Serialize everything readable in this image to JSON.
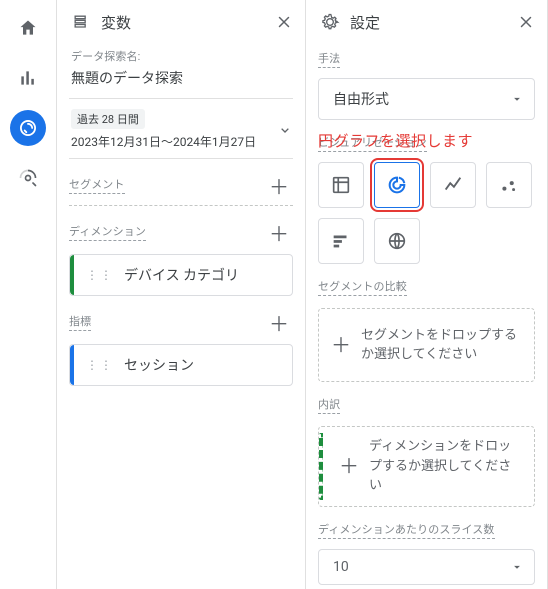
{
  "nav": {
    "items": [
      {
        "name": "home-icon"
      },
      {
        "name": "chart-icon"
      },
      {
        "name": "explore-icon"
      },
      {
        "name": "ads-icon"
      }
    ],
    "active_index": 2
  },
  "variables_panel": {
    "title": "変数",
    "exploration_name_label": "データ探索名:",
    "exploration_name_value": "無題のデータ探索",
    "date_chip": "過去 28 日間",
    "date_range": "2023年12月31日～2024年1月27日",
    "segments_label": "セグメント",
    "dimensions_label": "ディメンション",
    "dimension_chip": "デバイス カテゴリ",
    "metrics_label": "指標",
    "metric_chip": "セッション"
  },
  "settings_panel": {
    "title": "設定",
    "technique_label": "手法",
    "technique_value": "自由形式",
    "visualization_label": "ビジュアリゼーション",
    "annotation_text": "円グラフを選択します",
    "viz_items": [
      {
        "name": "table-icon"
      },
      {
        "name": "donut-icon"
      },
      {
        "name": "line-icon"
      },
      {
        "name": "scatter-icon"
      },
      {
        "name": "bar-icon"
      },
      {
        "name": "geo-icon"
      }
    ],
    "viz_selected_index": 1,
    "viz_highlight_index": 1,
    "segment_compare_label": "セグメントの比較",
    "segment_compare_placeholder": "セグメントをドロップするか選択してください",
    "breakdown_label": "内訳",
    "breakdown_placeholder": "ディメンションをドロップするか選択してください",
    "slices_label": "ディメンションあたりのスライス数",
    "slices_value": "10"
  }
}
